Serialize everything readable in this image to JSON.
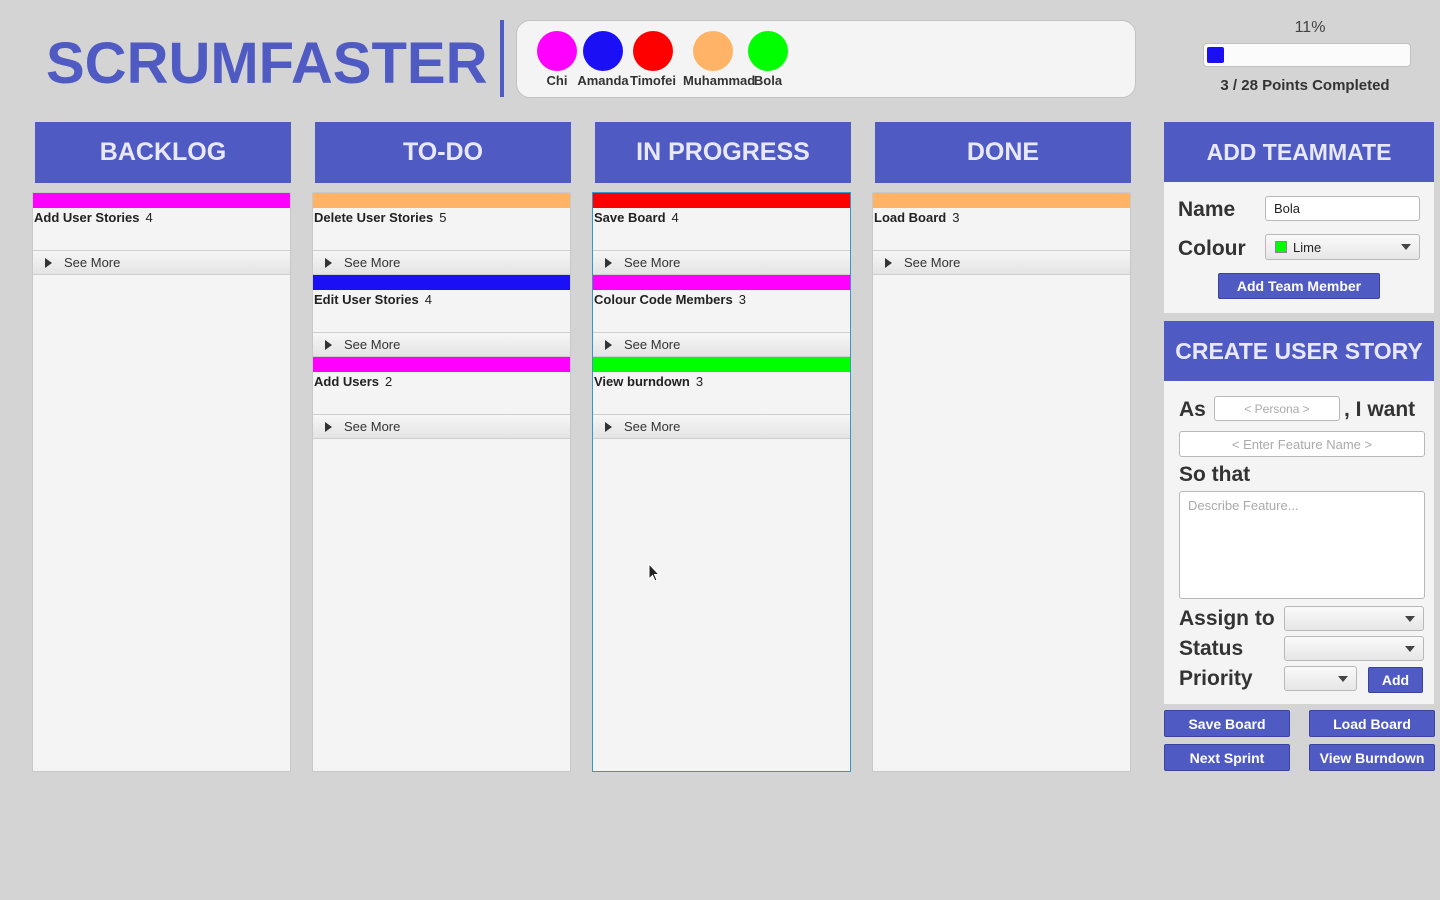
{
  "app": {
    "title": "SCRUMFASTER"
  },
  "team": [
    {
      "name": "Chi",
      "color": "#ff00ff"
    },
    {
      "name": "Amanda",
      "color": "#1a0ff5"
    },
    {
      "name": "Timofei",
      "color": "#ff0000"
    },
    {
      "name": "Muhammad",
      "color": "#ffb366"
    },
    {
      "name": "Bola",
      "color": "#00ff00"
    }
  ],
  "progress": {
    "percent_label": "11%",
    "fraction": 0.11,
    "caption": "3 / 28 Points Completed",
    "color": "#1a0ff5"
  },
  "columns": [
    {
      "title": "BACKLOG",
      "cards": [
        {
          "title": "Add User Stories",
          "points": "4",
          "color": "#ff00ff",
          "see_more": "See More"
        }
      ]
    },
    {
      "title": "TO-DO",
      "cards": [
        {
          "title": "Delete User Stories",
          "points": "5",
          "color": "#ffb366",
          "see_more": "See More"
        },
        {
          "title": "Edit User Stories",
          "points": "4",
          "color": "#1a0ff5",
          "see_more": "See More"
        },
        {
          "title": "Add Users",
          "points": "2",
          "color": "#ff00ff",
          "see_more": "See More"
        }
      ]
    },
    {
      "title": "IN PROGRESS",
      "cards": [
        {
          "title": "Save Board",
          "points": "4",
          "color": "#ff0000",
          "see_more": "See More"
        },
        {
          "title": "Colour Code Members",
          "points": "3",
          "color": "#ff00ff",
          "see_more": "See More"
        },
        {
          "title": "View burndown",
          "points": "3",
          "color": "#00ff00",
          "see_more": "See More"
        }
      ]
    },
    {
      "title": "DONE",
      "cards": [
        {
          "title": "Load Board",
          "points": "3",
          "color": "#ffb366",
          "see_more": "See More"
        }
      ]
    }
  ],
  "add_teammate": {
    "title": "ADD TEAMMATE",
    "name_label": "Name",
    "name_value": "Bola",
    "colour_label": "Colour",
    "colour_value": "Lime",
    "colour_swatch": "#00ff00",
    "button": "Add Team Member"
  },
  "create_story": {
    "title": "CREATE USER STORY",
    "as_label": "As",
    "persona_placeholder": "< Persona >",
    "want_label": ", I want",
    "feature_placeholder": "< Enter Feature Name >",
    "so_that_label": "So that",
    "describe_placeholder": "Describe Feature...",
    "assign_label": "Assign to",
    "status_label": "Status",
    "priority_label": "Priority",
    "add_button": "Add"
  },
  "actions": {
    "save_board": "Save Board",
    "load_board": "Load Board",
    "next_sprint": "Next Sprint",
    "view_burndown": "View Burndown"
  },
  "colors": {
    "accent": "#4f5bc2",
    "background": "#d4d4d4"
  }
}
